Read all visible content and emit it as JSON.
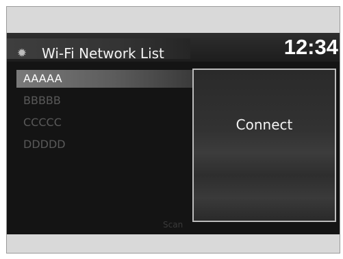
{
  "header": {
    "icon": "gear-icon",
    "title": "Wi-Fi Network List",
    "clock": "12:34"
  },
  "networks": [
    {
      "ssid": "AAAAA",
      "selected": true
    },
    {
      "ssid": "BBBBB",
      "selected": false
    },
    {
      "ssid": "CCCCC",
      "selected": false
    },
    {
      "ssid": "DDDDD",
      "selected": false
    }
  ],
  "panel": {
    "connect_label": "Connect"
  },
  "footer": {
    "scan_label": "Scan"
  }
}
